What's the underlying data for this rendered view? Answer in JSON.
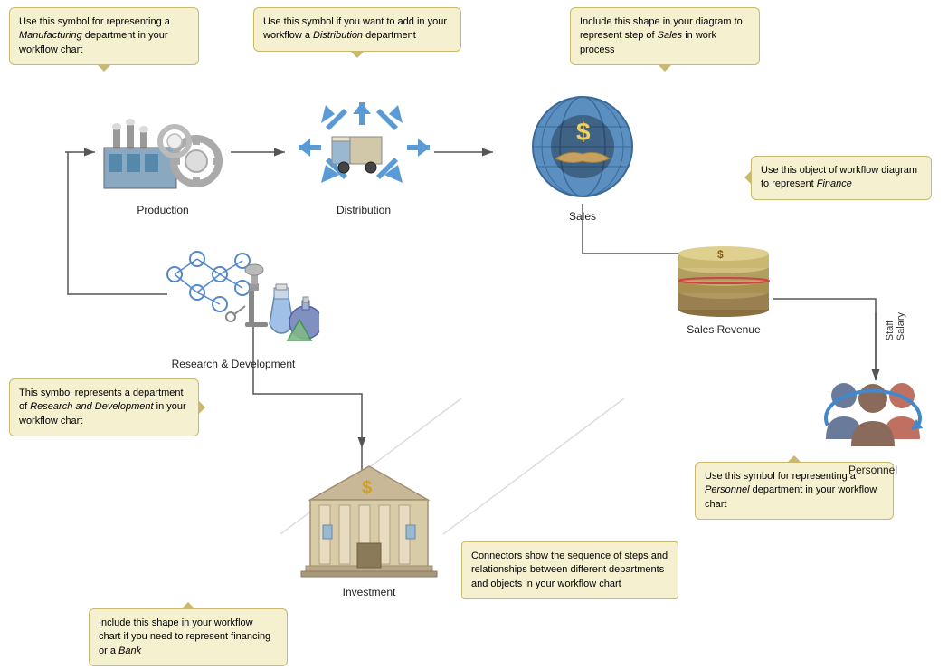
{
  "tooltips": {
    "manufacturing": "Use this symbol for representing a Manufacturing department in your workflow chart",
    "distribution": "Use this symbol if you want to add in your workflow a Distribution department",
    "sales": "Include this shape in your diagram to represent step of Sales in work process",
    "finance": "Use this object of workflow diagram to represent Finance",
    "research": "This symbol represents a department of Research and Development in your workflow chart",
    "personnel": "Use this symbol for representing a Personnel department in your workflow chart",
    "bank": "Include this shape in your workflow chart if you need to represent financing or a Bank",
    "connectors": "Connectors show the sequence of steps and relationships between different departments and objects in your workflow chart"
  },
  "labels": {
    "production": "Production",
    "distribution": "Distribution",
    "sales": "Sales",
    "salesRevenue": "Sales Revenue",
    "research": "Research & Development",
    "personnel": "Personnel",
    "investment": "Investment",
    "staffSalary": "Staff Salary"
  },
  "italic": {
    "manufacturing": "Manufacturing",
    "distribution": "Distribution",
    "sales": "Sales",
    "finance": "Finance",
    "research": "Research and Development",
    "personnel": "Personnel",
    "bank": "Bank"
  }
}
